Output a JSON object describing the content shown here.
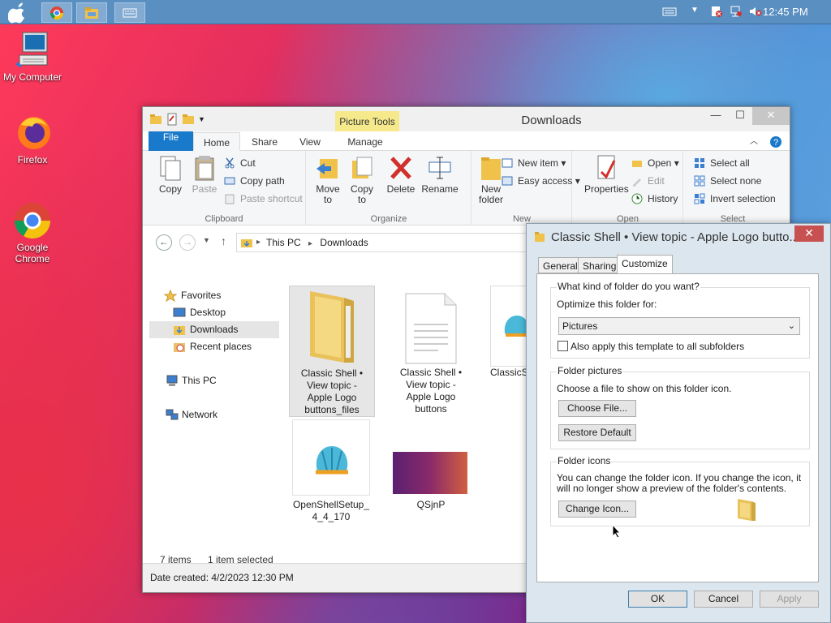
{
  "taskbar": {
    "clock": "12:45 PM"
  },
  "desktop": {
    "icons": [
      {
        "label": "My Computer"
      },
      {
        "label": "Firefox"
      },
      {
        "label": "Google Chrome"
      }
    ]
  },
  "explorer": {
    "title": "Downloads",
    "picture_tools": "Picture Tools",
    "tabs": {
      "file": "File",
      "home": "Home",
      "share": "Share",
      "view": "View",
      "manage": "Manage"
    },
    "ribbon": {
      "copy": "Copy",
      "paste": "Paste",
      "cut": "Cut",
      "copy_path": "Copy path",
      "paste_shortcut": "Paste shortcut",
      "clipboard": "Clipboard",
      "move_to": "Move to",
      "copy_to": "Copy to",
      "delete": "Delete",
      "rename": "Rename",
      "organize": "Organize",
      "new_folder": "New folder",
      "new_item": "New item",
      "easy_access": "Easy access",
      "new": "New",
      "properties": "Properties",
      "open": "Open",
      "edit": "Edit",
      "history": "History",
      "open_group": "Open",
      "select_all": "Select all",
      "select_none": "Select none",
      "invert_selection": "Invert selection",
      "select": "Select"
    },
    "path": {
      "this_pc": "This PC",
      "downloads": "Downloads"
    },
    "nav": {
      "favorites": "Favorites",
      "desktop": "Desktop",
      "downloads": "Downloads",
      "recent": "Recent places",
      "this_pc": "This PC",
      "network": "Network"
    },
    "files": [
      {
        "name": "Classic Shell • View topic - Apple Logo buttons_files"
      },
      {
        "name": "Classic Shell • View topic - Apple Logo buttons"
      },
      {
        "name": "ClassicS... _4..."
      },
      {
        "name": "OpenShellSetup_ 4_4_170"
      },
      {
        "name": "QSjnP"
      }
    ],
    "status": {
      "items": "7 items",
      "selected": "1 item selected"
    },
    "info": "Date created: 4/2/2023 12:30 PM"
  },
  "dialog": {
    "title": "Classic Shell • View topic - Apple Logo butto...",
    "tabs": {
      "general": "General",
      "sharing": "Sharing",
      "customize": "Customize"
    },
    "q1": "What kind of folder do you want?",
    "optimize_label": "Optimize this folder for:",
    "optimize_value": "Pictures",
    "also_apply": "Also apply this template to all subfolders",
    "folder_pictures": "Folder pictures",
    "choose_file_text": "Choose a file to show on this folder icon.",
    "choose_file_btn": "Choose File...",
    "restore_btn": "Restore Default",
    "folder_icons": "Folder icons",
    "icons_text": "You can change the folder icon. If you change the icon, it will no longer show a preview of the folder's contents.",
    "change_icon_btn": "Change Icon...",
    "ok": "OK",
    "cancel": "Cancel",
    "apply": "Apply"
  }
}
